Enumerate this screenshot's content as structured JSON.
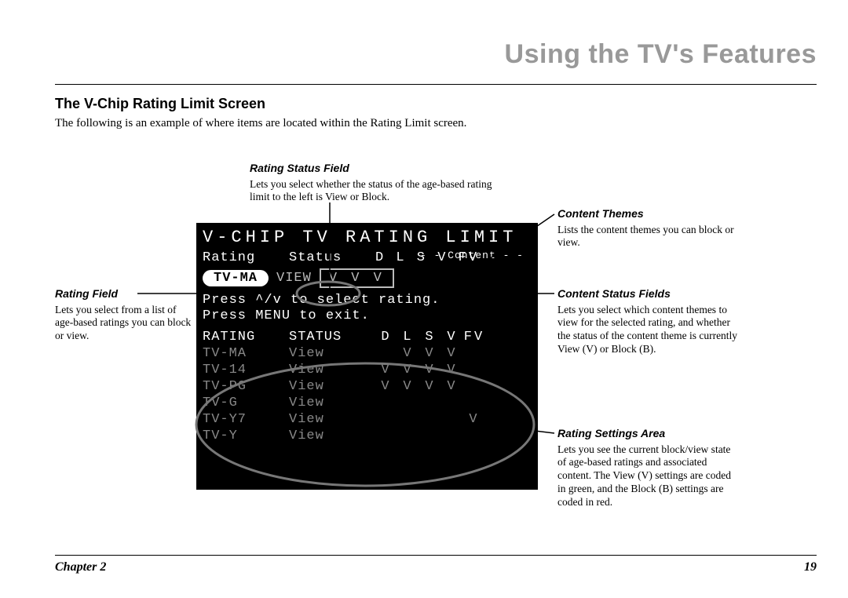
{
  "header": {
    "chapter_title": "Using the TV's Features"
  },
  "section": {
    "title": "The V-Chip Rating Limit Screen",
    "intro": "The following is an example of where items are located within the Rating Limit screen."
  },
  "callouts": {
    "rating_status_field": {
      "title": "Rating Status Field",
      "body": "Lets you select whether the status of the age-based rating limit to the left is View or Block."
    },
    "rating_field": {
      "title": "Rating Field",
      "body": "Lets you select from a list of age-based ratings you can block or view."
    },
    "content_themes": {
      "title": "Content Themes",
      "body": "Lists the content themes you can block or view."
    },
    "content_status_fields": {
      "title": "Content Status Fields",
      "body": "Lets you select which content themes to view for the selected rating, and whether the status of the content theme is currently View (V) or Block (B)."
    },
    "rating_settings_area": {
      "title": "Rating Settings Area",
      "body": "Lets you see the current block/view state of age-based ratings and associated content. The View (V) settings are coded in green, and the Block (B) settings are coded in red."
    }
  },
  "tv": {
    "title": "V-CHIP TV RATING LIMIT",
    "content_header": "- - Content - -",
    "cols": {
      "rating": "Rating",
      "status": "Status",
      "themes": "D L S V FV"
    },
    "selected": {
      "rating": "TV-MA",
      "status": "VIEW",
      "themes": "V V V"
    },
    "hint1": "Press ^/v to select rating.",
    "hint2": "Press MENU to exit.",
    "table_cols": {
      "rating": "RATING",
      "status": "STATUS",
      "themes_arr": [
        "D",
        "L",
        "S",
        "V",
        "FV"
      ]
    },
    "rows": [
      {
        "rating": "TV-MA",
        "status": "View",
        "t": [
          "",
          "V",
          "V",
          "V",
          ""
        ]
      },
      {
        "rating": "TV-14",
        "status": "View",
        "t": [
          "V",
          "V",
          "V",
          "V",
          ""
        ]
      },
      {
        "rating": "TV-PG",
        "status": "View",
        "t": [
          "V",
          "V",
          "V",
          "V",
          ""
        ]
      },
      {
        "rating": "TV-G",
        "status": "View",
        "t": [
          "",
          "",
          "",
          "",
          ""
        ]
      },
      {
        "rating": "TV-Y7",
        "status": "View",
        "t": [
          "",
          "",
          "",
          "",
          "V"
        ]
      },
      {
        "rating": "TV-Y",
        "status": "View",
        "t": [
          "",
          "",
          "",
          "",
          ""
        ]
      }
    ]
  },
  "footer": {
    "chapter": "Chapter 2",
    "page": "19"
  }
}
